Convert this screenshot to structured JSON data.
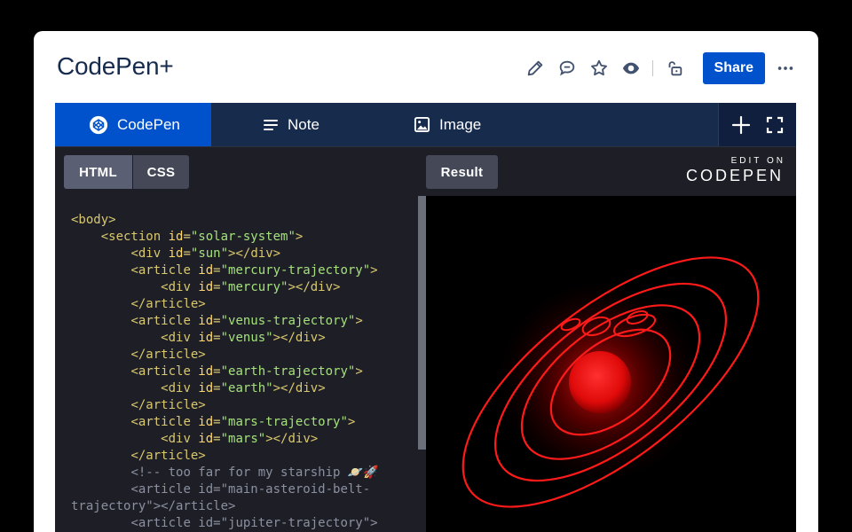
{
  "page": {
    "title": "CodePen+"
  },
  "toolbar": {
    "share_label": "Share"
  },
  "macro": {
    "tabs": [
      {
        "label": "CodePen",
        "icon": "codepen-icon",
        "active": true
      },
      {
        "label": "Note",
        "icon": "note-lines-icon",
        "active": false
      },
      {
        "label": "Image",
        "icon": "image-icon",
        "active": false
      }
    ],
    "tools": [
      "plus-icon",
      "fullscreen-icon"
    ]
  },
  "codepen": {
    "editor_tabs": [
      "HTML",
      "CSS"
    ],
    "active_tab": "HTML",
    "result_label": "Result",
    "edit_on_small": "EDIT ON",
    "edit_on_big": "CODEPEN"
  },
  "code_lines": [
    [
      {
        "t": "tag",
        "s": "<body>"
      }
    ],
    [
      {
        "t": "txt",
        "s": "    "
      },
      {
        "t": "tag",
        "s": "<section "
      },
      {
        "t": "attr",
        "s": "id"
      },
      {
        "t": "tag",
        "s": "="
      },
      {
        "t": "val",
        "s": "\"solar-system\""
      },
      {
        "t": "tag",
        "s": ">"
      }
    ],
    [
      {
        "t": "txt",
        "s": "        "
      },
      {
        "t": "tag",
        "s": "<div "
      },
      {
        "t": "attr",
        "s": "id"
      },
      {
        "t": "tag",
        "s": "="
      },
      {
        "t": "val",
        "s": "\"sun\""
      },
      {
        "t": "tag",
        "s": "></div>"
      }
    ],
    [
      {
        "t": "txt",
        "s": "        "
      },
      {
        "t": "tag",
        "s": "<article "
      },
      {
        "t": "attr",
        "s": "id"
      },
      {
        "t": "tag",
        "s": "="
      },
      {
        "t": "val",
        "s": "\"mercury-trajectory\""
      },
      {
        "t": "tag",
        "s": ">"
      }
    ],
    [
      {
        "t": "txt",
        "s": "            "
      },
      {
        "t": "tag",
        "s": "<div "
      },
      {
        "t": "attr",
        "s": "id"
      },
      {
        "t": "tag",
        "s": "="
      },
      {
        "t": "val",
        "s": "\"mercury\""
      },
      {
        "t": "tag",
        "s": "></div>"
      }
    ],
    [
      {
        "t": "txt",
        "s": "        "
      },
      {
        "t": "tag",
        "s": "</article>"
      }
    ],
    [
      {
        "t": "txt",
        "s": "        "
      },
      {
        "t": "tag",
        "s": "<article "
      },
      {
        "t": "attr",
        "s": "id"
      },
      {
        "t": "tag",
        "s": "="
      },
      {
        "t": "val",
        "s": "\"venus-trajectory\""
      },
      {
        "t": "tag",
        "s": ">"
      }
    ],
    [
      {
        "t": "txt",
        "s": "            "
      },
      {
        "t": "tag",
        "s": "<div "
      },
      {
        "t": "attr",
        "s": "id"
      },
      {
        "t": "tag",
        "s": "="
      },
      {
        "t": "val",
        "s": "\"venus\""
      },
      {
        "t": "tag",
        "s": "></div>"
      }
    ],
    [
      {
        "t": "txt",
        "s": "        "
      },
      {
        "t": "tag",
        "s": "</article>"
      }
    ],
    [
      {
        "t": "txt",
        "s": "        "
      },
      {
        "t": "tag",
        "s": "<article "
      },
      {
        "t": "attr",
        "s": "id"
      },
      {
        "t": "tag",
        "s": "="
      },
      {
        "t": "val",
        "s": "\"earth-trajectory\""
      },
      {
        "t": "tag",
        "s": ">"
      }
    ],
    [
      {
        "t": "txt",
        "s": "            "
      },
      {
        "t": "tag",
        "s": "<div "
      },
      {
        "t": "attr",
        "s": "id"
      },
      {
        "t": "tag",
        "s": "="
      },
      {
        "t": "val",
        "s": "\"earth\""
      },
      {
        "t": "tag",
        "s": "></div>"
      }
    ],
    [
      {
        "t": "txt",
        "s": "        "
      },
      {
        "t": "tag",
        "s": "</article>"
      }
    ],
    [
      {
        "t": "txt",
        "s": "        "
      },
      {
        "t": "tag",
        "s": "<article "
      },
      {
        "t": "attr",
        "s": "id"
      },
      {
        "t": "tag",
        "s": "="
      },
      {
        "t": "val",
        "s": "\"mars-trajectory\""
      },
      {
        "t": "tag",
        "s": ">"
      }
    ],
    [
      {
        "t": "txt",
        "s": "            "
      },
      {
        "t": "tag",
        "s": "<div "
      },
      {
        "t": "attr",
        "s": "id"
      },
      {
        "t": "tag",
        "s": "="
      },
      {
        "t": "val",
        "s": "\"mars\""
      },
      {
        "t": "tag",
        "s": "></div>"
      }
    ],
    [
      {
        "t": "txt",
        "s": "        "
      },
      {
        "t": "tag",
        "s": "</article>"
      }
    ],
    [
      {
        "t": "txt",
        "s": "        "
      },
      {
        "t": "comment",
        "s": "<!-- too far for my starship 🪐🚀"
      }
    ],
    [
      {
        "t": "txt",
        "s": "        "
      },
      {
        "t": "comment",
        "s": "<article id=\"main-asteroid-belt-"
      }
    ],
    [
      {
        "t": "comment",
        "s": "trajectory\"></article>"
      }
    ],
    [
      {
        "t": "txt",
        "s": "        "
      },
      {
        "t": "comment",
        "s": "<article id=\"jupiter-trajectory\">"
      }
    ]
  ],
  "colors": {
    "brand_blue": "#0052cc",
    "nav_navy": "#172b4d",
    "planet_red": "#ff2020"
  }
}
